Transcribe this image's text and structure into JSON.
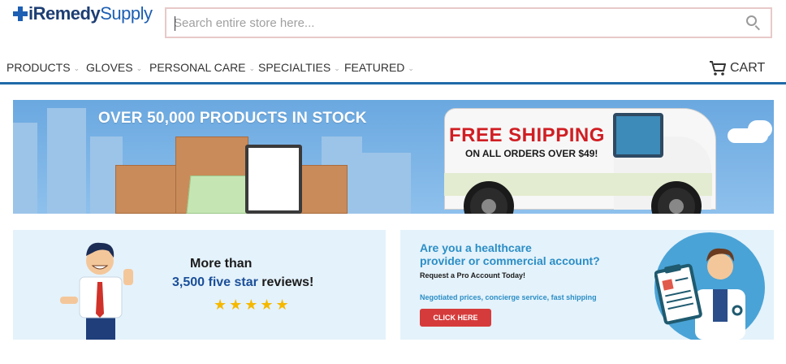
{
  "header": {
    "logo": {
      "part1": "iRemedy",
      "part2": "Supply"
    },
    "search": {
      "placeholder": "Search entire store here...",
      "value": ""
    }
  },
  "nav": {
    "items": [
      {
        "label": "PRODUCTS"
      },
      {
        "label": "GLOVES"
      },
      {
        "label": "PERSONAL CARE"
      },
      {
        "label": "SPECIALTIES"
      },
      {
        "label": "FEATURED"
      }
    ],
    "cart_label": "CART"
  },
  "banners": {
    "stock_shipping": {
      "stock_title": "OVER 50,000 PRODUCTS IN STOCK",
      "free_shipping": "FREE SHIPPING",
      "free_shipping_sub": "ON ALL ORDERS OVER $49!"
    },
    "reviews": {
      "line1": "More than",
      "line2_blue": "3,500 five star",
      "line2_dark": " reviews!",
      "stars": "★★★★★"
    },
    "pro_account": {
      "title_line1": "Are you a healthcare",
      "title_line2": "provider or commercial account?",
      "subtitle": "Request a Pro Account Today!",
      "perks": "Negotiated prices, concierge service, fast shipping",
      "cta": "CLICK HERE"
    }
  },
  "colors": {
    "brand_blue": "#1d5fb3",
    "nav_rule": "#1f6aa8",
    "cta_red": "#d63b3b",
    "star_gold": "#f5b800"
  }
}
